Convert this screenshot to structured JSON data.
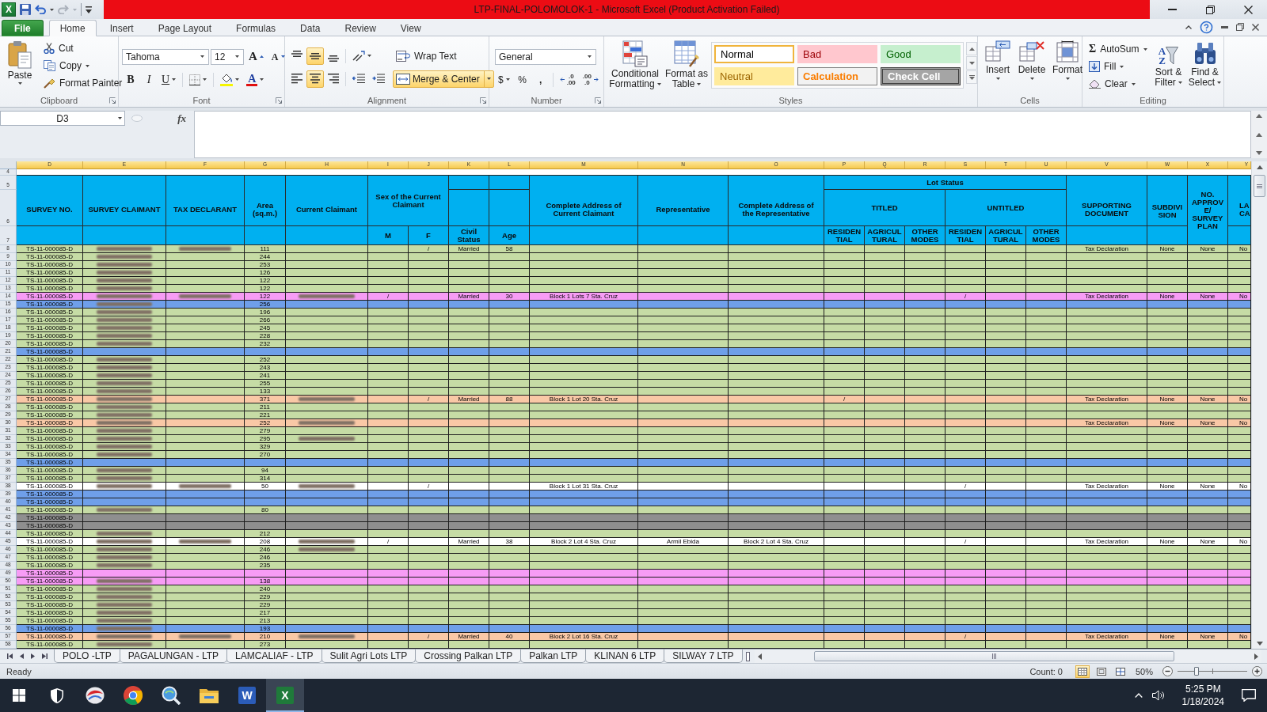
{
  "window": {
    "app_badge": "X",
    "title": "LTP-FINAL-POLOMOLOK-1 - Microsoft Excel (Product Activation Failed)"
  },
  "ribbon_tabs": [
    {
      "label": "File",
      "kind": "file",
      "selected": false
    },
    {
      "label": "Home",
      "kind": "tab",
      "selected": true
    },
    {
      "label": "Insert",
      "kind": "tab",
      "selected": false
    },
    {
      "label": "Page Layout",
      "kind": "tab",
      "selected": false
    },
    {
      "label": "Formulas",
      "kind": "tab",
      "selected": false
    },
    {
      "label": "Data",
      "kind": "tab",
      "selected": false
    },
    {
      "label": "Review",
      "kind": "tab",
      "selected": false
    },
    {
      "label": "View",
      "kind": "tab",
      "selected": false
    }
  ],
  "clipboard": {
    "paste": "Paste",
    "cut": "Cut",
    "copy": "Copy",
    "format_painter": "Format Painter",
    "label": "Clipboard"
  },
  "font": {
    "name": "Tahoma",
    "size": "12",
    "grow": "A",
    "shrink": "A",
    "bold": "B",
    "italic": "I",
    "underline": "U",
    "font_color_button": "A",
    "label": "Font"
  },
  "alignment": {
    "vertical": [
      {
        "kind": "top",
        "selected": false
      },
      {
        "kind": "middle",
        "selected": true
      },
      {
        "kind": "bottom",
        "selected": false
      }
    ],
    "horizontal": [
      {
        "kind": "left",
        "selected": false
      },
      {
        "kind": "center",
        "selected": true
      },
      {
        "kind": "right",
        "selected": false
      }
    ],
    "wrap_text": "Wrap Text",
    "merge_center": {
      "label": "Merge & Center",
      "selected": true
    },
    "label": "Alignment"
  },
  "number": {
    "format": "General",
    "currency": "$",
    "percent": "%",
    "comma": ",",
    "increase_decimal": [
      ".0",
      ".00"
    ],
    "decrease_decimal": [
      ".00",
      ".0"
    ],
    "label": "Number"
  },
  "styles": {
    "conditional_formatting": "Conditional Formatting",
    "format_as_table": "Format as Table",
    "gallery": [
      {
        "label": "Normal",
        "kind": "normal",
        "selected": true
      },
      {
        "label": "Bad",
        "kind": "bad",
        "selected": false
      },
      {
        "label": "Good",
        "kind": "good",
        "selected": false
      },
      {
        "label": "Neutral",
        "kind": "neutral",
        "selected": false
      },
      {
        "label": "Calculation",
        "kind": "calculation",
        "selected": false
      },
      {
        "label": "Check Cell",
        "kind": "check",
        "selected": false
      }
    ],
    "label": "Styles"
  },
  "cells": {
    "insert": "Insert",
    "delete": "Delete",
    "format": "Format",
    "label": "Cells"
  },
  "editing": {
    "autosum_symbol": "Σ",
    "autosum": "AutoSum",
    "fill": "Fill",
    "clear": "Clear",
    "sort_letters": [
      "A",
      "Z"
    ],
    "sort_filter": "Sort & Filter",
    "find_select": "Find & Select",
    "label": "Editing"
  },
  "formula_bar": {
    "name_box": "D3",
    "function_button": "fx"
  },
  "sheet": {
    "column_letters": [
      "D",
      "E",
      "F",
      "G",
      "H",
      "I",
      "J",
      "K",
      "L",
      "M",
      "N",
      "O",
      "P",
      "Q",
      "R",
      "S",
      "T",
      "U",
      "V",
      "W",
      "X",
      "Y"
    ],
    "blank_row": "4",
    "header_rows": [
      "5",
      "6",
      "7"
    ],
    "header": {
      "survey_no": "SURVEY NO.",
      "survey_claimant": "SURVEY CLAIMANT",
      "tax_declarant": "TAX DECLARANT",
      "area": "Area (sq.m.)",
      "current_claimant": "Current Claimant",
      "sex": "Sex of the Current Claimant",
      "male": "M",
      "female": "F",
      "civil_status": "Civil Status",
      "age": "Age",
      "address": "Complete Address of Current Claimant",
      "representative": "Representative",
      "rep_address": "Complete Address of the Representative",
      "lot_status": "Lot Status",
      "titled": "TITLED",
      "untitled": "UNTITLED",
      "lot_types": [
        "RESIDEN TIAL",
        "AGRICUL TURAL",
        "OTHER MODES",
        "RESIDEN TIAL",
        "AGRICUL TURAL",
        "OTHER MODES"
      ],
      "supporting_document": "SUPPORTING DOCUMENT",
      "subdivision": "SUBDIVI SION",
      "approved_plan": "NO. APPROV E/ SURVEY PLAN",
      "column_y": "LA CA"
    },
    "rows": [
      {
        "num": "8",
        "color": "#c6dca5",
        "survey_no": "TS-11-000085-D",
        "claimant_blurred": true,
        "declarant_blurred": true,
        "current_claimant_blurred": false,
        "area": "111",
        "female": "/",
        "civil_status": "Married",
        "age": "58",
        "supporting_document": "Tax Declaration",
        "subdivision": "None",
        "approved_plan": "None",
        "column_y": "No"
      },
      {
        "num": "9",
        "color": "#c6dca5",
        "survey_no": "TS-11-000085-D",
        "claimant_blurred": true,
        "declarant_blurred": false,
        "current_claimant_blurred": false,
        "area": "244"
      },
      {
        "num": "10",
        "color": "#c6dca5",
        "survey_no": "TS-11-000085-D",
        "claimant_blurred": true,
        "declarant_blurred": false,
        "current_claimant_blurred": false,
        "area": "253"
      },
      {
        "num": "11",
        "color": "#c6dca5",
        "survey_no": "TS-11-000085-D",
        "claimant_blurred": true,
        "declarant_blurred": false,
        "current_claimant_blurred": false,
        "area": "126"
      },
      {
        "num": "12",
        "color": "#c6dca5",
        "survey_no": "TS-11-000085-D",
        "claimant_blurred": true,
        "declarant_blurred": false,
        "current_claimant_blurred": false,
        "area": "122"
      },
      {
        "num": "13",
        "color": "#c6dca5",
        "survey_no": "TS-11-000085-D",
        "claimant_blurred": true,
        "declarant_blurred": false,
        "current_claimant_blurred": false,
        "area": "122"
      },
      {
        "num": "14",
        "color": "#f79cf5",
        "survey_no": "TS-11-000085-D",
        "claimant_blurred": true,
        "declarant_blurred": true,
        "current_claimant_blurred": true,
        "area": "122",
        "male": "/",
        "civil_status": "Married",
        "age": "30",
        "address": "Block 1 Lots 7 Sta. Cruz",
        "untitled_residential": "/",
        "supporting_document": "Tax Declaration",
        "subdivision": "None",
        "approved_plan": "None",
        "column_y": "No"
      },
      {
        "num": "15",
        "color": "#6f9fe9",
        "survey_no": "TS-11-000085-D",
        "claimant_blurred": true,
        "declarant_blurred": false,
        "current_claimant_blurred": false,
        "area": "256"
      },
      {
        "num": "16",
        "color": "#c6dca5",
        "survey_no": "TS-11-000085-D",
        "claimant_blurred": true,
        "declarant_blurred": false,
        "current_claimant_blurred": false,
        "area": "196"
      },
      {
        "num": "17",
        "color": "#c6dca5",
        "survey_no": "TS-11-000085-D",
        "claimant_blurred": true,
        "declarant_blurred": false,
        "current_claimant_blurred": false,
        "area": "266"
      },
      {
        "num": "18",
        "color": "#c6dca5",
        "survey_no": "TS-11-000085-D",
        "claimant_blurred": true,
        "declarant_blurred": false,
        "current_claimant_blurred": false,
        "area": "245"
      },
      {
        "num": "19",
        "color": "#c6dca5",
        "survey_no": "TS-11-000085-D",
        "claimant_blurred": true,
        "declarant_blurred": false,
        "current_claimant_blurred": false,
        "area": "228"
      },
      {
        "num": "20",
        "color": "#c6dca5",
        "survey_no": "TS-11-000085-D",
        "claimant_blurred": true,
        "declarant_blurred": false,
        "current_claimant_blurred": false,
        "area": "232"
      },
      {
        "num": "21",
        "color": "#6f9fe9",
        "survey_no": "TS-11-000085-D",
        "claimant_blurred": false,
        "declarant_blurred": false,
        "current_claimant_blurred": false
      },
      {
        "num": "22",
        "color": "#c6dca5",
        "survey_no": "TS-11-000085-D",
        "claimant_blurred": true,
        "declarant_blurred": false,
        "current_claimant_blurred": false,
        "area": "252"
      },
      {
        "num": "23",
        "color": "#c6dca5",
        "survey_no": "TS-11-000085-D",
        "claimant_blurred": true,
        "declarant_blurred": false,
        "current_claimant_blurred": false,
        "area": "243"
      },
      {
        "num": "24",
        "color": "#c6dca5",
        "survey_no": "TS-11-000085-D",
        "claimant_blurred": true,
        "declarant_blurred": false,
        "current_claimant_blurred": false,
        "area": "241"
      },
      {
        "num": "25",
        "color": "#c6dca5",
        "survey_no": "TS-11-000085-D",
        "claimant_blurred": true,
        "declarant_blurred": false,
        "current_claimant_blurred": false,
        "area": "255"
      },
      {
        "num": "26",
        "color": "#c6dca5",
        "survey_no": "TS-11-000085-D",
        "claimant_blurred": true,
        "declarant_blurred": false,
        "current_claimant_blurred": false,
        "area": "133"
      },
      {
        "num": "27",
        "color": "#f9c8a6",
        "survey_no": "TS-11-000085-D",
        "claimant_blurred": true,
        "declarant_blurred": false,
        "current_claimant_blurred": true,
        "area": "371",
        "female": "/",
        "civil_status": "Married",
        "age": "88",
        "address": "Block 1 Lot 20 Sta. Cruz",
        "titled_residential": "/",
        "supporting_document": "Tax Declaration",
        "subdivision": "None",
        "approved_plan": "None",
        "column_y": "No"
      },
      {
        "num": "28",
        "color": "#c6dca5",
        "survey_no": "TS-11-000085-D",
        "claimant_blurred": true,
        "declarant_blurred": false,
        "current_claimant_blurred": false,
        "area": "211"
      },
      {
        "num": "29",
        "color": "#c6dca5",
        "survey_no": "TS-11-000085-D",
        "claimant_blurred": true,
        "declarant_blurred": false,
        "current_claimant_blurred": false,
        "area": "221"
      },
      {
        "num": "30",
        "color": "#f9c8a6",
        "survey_no": "TS-11-000085-D",
        "claimant_blurred": true,
        "declarant_blurred": false,
        "current_claimant_blurred": true,
        "area": "252",
        "supporting_document": "Tax Declaration",
        "subdivision": "None",
        "approved_plan": "None",
        "column_y": "No"
      },
      {
        "num": "31",
        "color": "#c6dca5",
        "survey_no": "TS-11-000085-D",
        "claimant_blurred": true,
        "declarant_blurred": false,
        "current_claimant_blurred": false,
        "area": "279"
      },
      {
        "num": "32",
        "color": "#c6dca5",
        "survey_no": "TS-11-000085-D",
        "claimant_blurred": true,
        "declarant_blurred": false,
        "current_claimant_blurred": true,
        "area": "295"
      },
      {
        "num": "33",
        "color": "#c6dca5",
        "survey_no": "TS-11-000085-D",
        "claimant_blurred": true,
        "declarant_blurred": false,
        "current_claimant_blurred": false,
        "area": "329"
      },
      {
        "num": "34",
        "color": "#c6dca5",
        "survey_no": "TS-11-000085-D",
        "claimant_blurred": true,
        "declarant_blurred": false,
        "current_claimant_blurred": false,
        "area": "270"
      },
      {
        "num": "35",
        "color": "#6f9fe9",
        "survey_no": "TS-11-000085-D",
        "claimant_blurred": false,
        "declarant_blurred": false,
        "current_claimant_blurred": false
      },
      {
        "num": "36",
        "color": "#c6dca5",
        "survey_no": "TS-11-000085-D",
        "claimant_blurred": true,
        "declarant_blurred": false,
        "current_claimant_blurred": false,
        "area": "94"
      },
      {
        "num": "37",
        "color": "#c6dca5",
        "survey_no": "TS-11-000085-D",
        "claimant_blurred": true,
        "declarant_blurred": false,
        "current_claimant_blurred": false,
        "area": "314"
      },
      {
        "num": "38",
        "color": "#ffffff",
        "survey_no": "TS-11-000085-D",
        "claimant_blurred": true,
        "declarant_blurred": true,
        "current_claimant_blurred": true,
        "area": "50",
        "female": "/",
        "address": "Block 1 Lot 31 Sta. Cruz",
        "untitled_residential": "/",
        "supporting_document": "Tax Declaration",
        "subdivision": "None",
        "approved_plan": "None",
        "column_y": "No"
      },
      {
        "num": "39",
        "color": "#6f9fe9",
        "survey_no": "TS-11-000085-D",
        "claimant_blurred": false,
        "declarant_blurred": false,
        "current_claimant_blurred": false
      },
      {
        "num": "40",
        "color": "#6f9fe9",
        "survey_no": "TS-11-000085-D",
        "claimant_blurred": false,
        "declarant_blurred": false,
        "current_claimant_blurred": false
      },
      {
        "num": "41",
        "color": "#c6dca5",
        "survey_no": "TS-11-000085-D",
        "claimant_blurred": true,
        "declarant_blurred": false,
        "current_claimant_blurred": false,
        "area": "80"
      },
      {
        "num": "42",
        "color": "#8f8f8f",
        "survey_no": "TS-11-000085-D",
        "claimant_blurred": false,
        "declarant_blurred": false,
        "current_claimant_blurred": false
      },
      {
        "num": "43",
        "color": "#8f8f8f",
        "survey_no": "TS-11-000085-D",
        "claimant_blurred": false,
        "declarant_blurred": false,
        "current_claimant_blurred": false
      },
      {
        "num": "44",
        "color": "#c6dca5",
        "survey_no": "TS-11-000085-D",
        "claimant_blurred": true,
        "declarant_blurred": false,
        "current_claimant_blurred": false,
        "area": "212"
      },
      {
        "num": "45",
        "color": "#ffffff",
        "survey_no": "TS-11-000085-D",
        "claimant_blurred": true,
        "declarant_blurred": true,
        "current_claimant_blurred": true,
        "area": "208",
        "male": "/",
        "civil_status": "Married",
        "age": "38",
        "address": "Block 2 Lot 4 Sta. Cruz",
        "representative": "Armil Ebida",
        "rep_address": "Block 2 Lot 4 Sta. Cruz",
        "untitled_residential": "/",
        "supporting_document": "Tax Declaration",
        "subdivision": "None",
        "approved_plan": "None",
        "column_y": "No"
      },
      {
        "num": "46",
        "color": "#c6dca5",
        "survey_no": "TS-11-000085-D",
        "claimant_blurred": true,
        "declarant_blurred": false,
        "current_claimant_blurred": true,
        "area": "246"
      },
      {
        "num": "47",
        "color": "#c6dca5",
        "survey_no": "TS-11-000085-D",
        "claimant_blurred": true,
        "declarant_blurred": false,
        "current_claimant_blurred": false,
        "area": "246"
      },
      {
        "num": "48",
        "color": "#c6dca5",
        "survey_no": "TS-11-000085-D",
        "claimant_blurred": true,
        "declarant_blurred": false,
        "current_claimant_blurred": false,
        "area": "235"
      },
      {
        "num": "49",
        "color": "#f79cf5",
        "survey_no": "TS-11-000085-D",
        "claimant_blurred": false,
        "declarant_blurred": false,
        "current_claimant_blurred": false
      },
      {
        "num": "50",
        "color": "#f79cf5",
        "survey_no": "TS-11-000085-D",
        "claimant_blurred": true,
        "declarant_blurred": false,
        "current_claimant_blurred": false,
        "area": "138"
      },
      {
        "num": "51",
        "color": "#c6dca5",
        "survey_no": "TS-11-000085-D",
        "claimant_blurred": true,
        "declarant_blurred": false,
        "current_claimant_blurred": false,
        "area": "240"
      },
      {
        "num": "52",
        "color": "#c6dca5",
        "survey_no": "TS-11-000085-D",
        "claimant_blurred": true,
        "declarant_blurred": false,
        "current_claimant_blurred": false,
        "area": "229"
      },
      {
        "num": "53",
        "color": "#c6dca5",
        "survey_no": "TS-11-000085-D",
        "claimant_blurred": true,
        "declarant_blurred": false,
        "current_claimant_blurred": false,
        "area": "229"
      },
      {
        "num": "54",
        "color": "#c6dca5",
        "survey_no": "TS-11-000085-D",
        "claimant_blurred": true,
        "declarant_blurred": false,
        "current_claimant_blurred": false,
        "area": "217"
      },
      {
        "num": "55",
        "color": "#c6dca5",
        "survey_no": "TS-11-000085-D",
        "claimant_blurred": true,
        "declarant_blurred": false,
        "current_claimant_blurred": false,
        "area": "213"
      },
      {
        "num": "56",
        "color": "#6f9fe9",
        "survey_no": "TS-11-000085-D",
        "claimant_blurred": true,
        "declarant_blurred": false,
        "current_claimant_blurred": false,
        "area": "193"
      },
      {
        "num": "57",
        "color": "#f9c8a6",
        "survey_no": "TS-11-000085-D",
        "claimant_blurred": true,
        "declarant_blurred": true,
        "current_claimant_blurred": true,
        "area": "210",
        "female": "/",
        "civil_status": "Married",
        "age": "40",
        "address": "Block 2 Lot 16 Sta. Cruz",
        "untitled_residential": "/",
        "supporting_document": "Tax Declaration",
        "subdivision": "None",
        "approved_plan": "None",
        "column_y": "No"
      },
      {
        "num": "58",
        "color": "#c6dca5",
        "survey_no": "TS-11-000085-D",
        "claimant_blurred": true,
        "declarant_blurred": false,
        "current_claimant_blurred": false,
        "area": "273"
      }
    ]
  },
  "sheet_tabs": [
    {
      "label": "POLO -LTP",
      "selected": false
    },
    {
      "label": "PAGALUNGAN - LTP",
      "selected": false
    },
    {
      "label": "LAMCALIAF - LTP",
      "selected": false
    },
    {
      "label": "Sulit Agri Lots LTP",
      "selected": false
    },
    {
      "label": "Crossing Palkan LTP",
      "selected": false
    },
    {
      "label": "Palkan LTP",
      "selected": false
    },
    {
      "label": "KLINAN 6 LTP",
      "selected": false
    },
    {
      "label": "SILWAY 7 LTP",
      "selected": false
    }
  ],
  "status_bar": {
    "mode": "Ready",
    "count": "Count: 0",
    "views": [
      {
        "kind": "normal",
        "selected": true
      },
      {
        "kind": "page_layout",
        "selected": false
      },
      {
        "kind": "page_break",
        "selected": false
      }
    ],
    "zoom": "50%",
    "zoom_slider": {
      "level": 0.27
    }
  },
  "taskbar": {
    "apps": [
      {
        "kind": "shield",
        "selected": false
      },
      {
        "kind": "swirl",
        "selected": false
      },
      {
        "kind": "browser",
        "selected": false
      },
      {
        "kind": "search",
        "selected": false
      },
      {
        "kind": "folder",
        "selected": false
      },
      {
        "kind": "word",
        "letter": "W",
        "selected": false
      },
      {
        "kind": "excel",
        "letter": "X",
        "selected": true
      }
    ],
    "time": "5:25 PM",
    "date": "1/18/2024"
  }
}
